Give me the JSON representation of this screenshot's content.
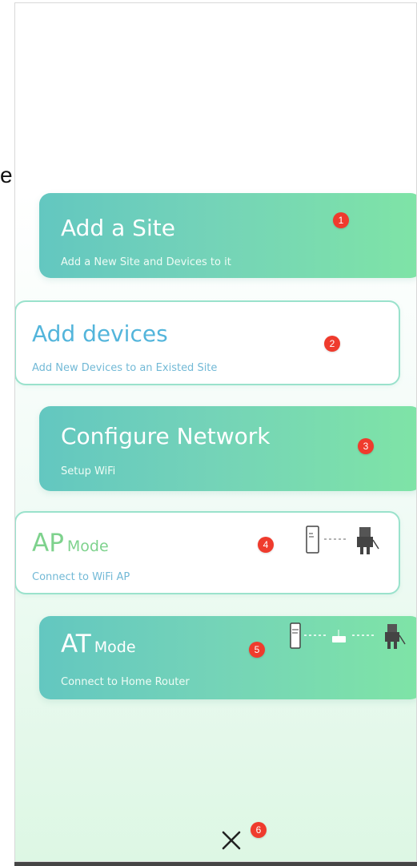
{
  "edge_fragment": "e",
  "menu": {
    "cards": [
      {
        "title": "Add a Site",
        "subtitle": "Add a New Site and Devices to it",
        "badge": "1"
      },
      {
        "title": "Add devices",
        "subtitle": "Add New Devices to an Existed Site",
        "badge": "2"
      },
      {
        "title": "Configure Network",
        "subtitle": "Setup WiFi",
        "badge": "3"
      },
      {
        "title_main": "AP",
        "title_sub": "Mode",
        "subtitle": "Connect to WiFi AP",
        "badge": "4"
      },
      {
        "title_main": "AT",
        "title_sub": "Mode",
        "subtitle": "Connect to Home Router",
        "badge": "5"
      }
    ]
  },
  "close": {
    "icon": "close-icon",
    "badge": "6"
  },
  "colors": {
    "card_gradient_start": "#63c7c0",
    "card_gradient_end": "#7fe4a6",
    "outline": "#9ae2cc",
    "blue_text": "#53b5db",
    "green_text": "#7ed28d",
    "badge_red": "#ef3b2d"
  }
}
